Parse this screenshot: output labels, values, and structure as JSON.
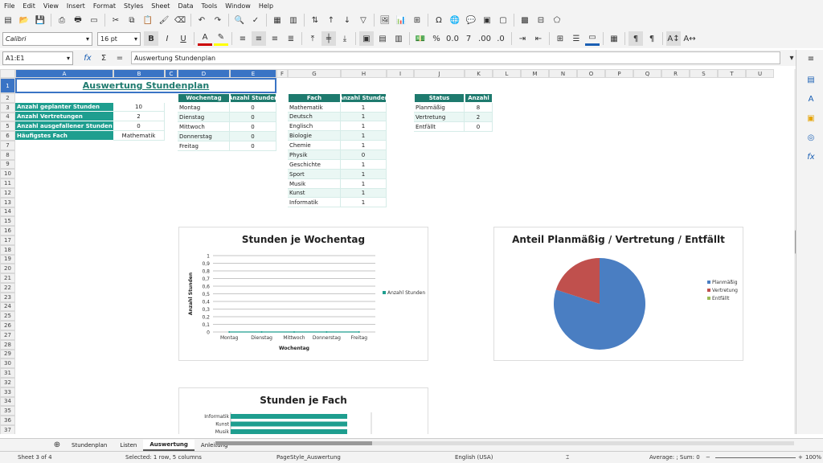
{
  "menu": [
    "File",
    "Edit",
    "View",
    "Insert",
    "Format",
    "Styles",
    "Sheet",
    "Data",
    "Tools",
    "Window",
    "Help"
  ],
  "toolbar": {
    "font_name": "Calibri",
    "font_size": "16 pt"
  },
  "formula_bar": {
    "name_box": "A1:E1",
    "content": "Auswertung Stundenplan",
    "fx": "fx",
    "sigma": "Σ",
    "eq": "="
  },
  "columns": [
    "A",
    "B",
    "C",
    "D",
    "E",
    "F",
    "G",
    "H",
    "I",
    "J",
    "K",
    "L",
    "M",
    "N",
    "O",
    "P",
    "Q",
    "R",
    "S",
    "T",
    "U"
  ],
  "rows": [
    "1",
    "2",
    "3",
    "4",
    "5",
    "6",
    "7",
    "8",
    "9",
    "10",
    "11",
    "12",
    "13",
    "14",
    "15",
    "16",
    "17",
    "18",
    "19",
    "20",
    "21",
    "22",
    "23",
    "24",
    "25",
    "26",
    "27",
    "28",
    "29",
    "30",
    "31",
    "32",
    "33",
    "34",
    "35",
    "36",
    "37"
  ],
  "title_cell": "Auswertung Stundenplan",
  "summary": [
    {
      "label": "Anzahl geplanter Stunden",
      "value": "10"
    },
    {
      "label": "Anzahl Vertretungen",
      "value": "2"
    },
    {
      "label": "Anzahl ausgefallener Stunden",
      "value": "0"
    },
    {
      "label": "Häufigstes Fach",
      "value": "Mathematik"
    }
  ],
  "weekday_table": {
    "headers": [
      "Wochentag",
      "Anzahl Stunden"
    ],
    "rows": [
      [
        "Montag",
        "0"
      ],
      [
        "Dienstag",
        "0"
      ],
      [
        "Mittwoch",
        "0"
      ],
      [
        "Donnerstag",
        "0"
      ],
      [
        "Freitag",
        "0"
      ]
    ]
  },
  "fach_table": {
    "headers": [
      "Fach",
      "Anzahl Stunden"
    ],
    "rows": [
      [
        "Mathematik",
        "1"
      ],
      [
        "Deutsch",
        "1"
      ],
      [
        "Englisch",
        "1"
      ],
      [
        "Biologie",
        "1"
      ],
      [
        "Chemie",
        "1"
      ],
      [
        "Physik",
        "0"
      ],
      [
        "Geschichte",
        "1"
      ],
      [
        "Sport",
        "1"
      ],
      [
        "Musik",
        "1"
      ],
      [
        "Kunst",
        "1"
      ],
      [
        "Informatik",
        "1"
      ]
    ]
  },
  "status_table": {
    "headers": [
      "Status",
      "Anzahl"
    ],
    "rows": [
      [
        "Planmäßig",
        "8"
      ],
      [
        "Vertretung",
        "2"
      ],
      [
        "Entfällt",
        "0"
      ]
    ]
  },
  "chart_data": [
    {
      "type": "line",
      "title": "Stunden je Wochentag",
      "xlabel": "Wochentag",
      "ylabel": "Anzahl Stunden",
      "categories": [
        "Montag",
        "Dienstag",
        "Mittwoch",
        "Donnerstag",
        "Freitag"
      ],
      "yticks": [
        "0",
        "0,1",
        "0,2",
        "0,3",
        "0,4",
        "0,5",
        "0,6",
        "0,7",
        "0,8",
        "0,9",
        "1"
      ],
      "ylim": [
        0,
        1
      ],
      "series": [
        {
          "name": "Anzahl Stunden",
          "values": [
            0,
            0,
            0,
            0,
            0
          ]
        }
      ],
      "legend": "right",
      "grid": true
    },
    {
      "type": "pie",
      "title": "Anteil Planmäßig / Vertretung / Entfällt",
      "categories": [
        "Planmäßig",
        "Vertretung",
        "Entfällt"
      ],
      "values": [
        8,
        2,
        0
      ],
      "colors": [
        "#4a7ec2",
        "#c0504d",
        "#9bbb59"
      ],
      "legend": "right"
    },
    {
      "type": "bar",
      "title": "Stunden je Fach",
      "categories": [
        "Informatik",
        "Kunst",
        "Musik"
      ],
      "values": [
        1,
        1,
        1
      ],
      "color": "#1e9e8f"
    }
  ],
  "sheet_tabs": [
    "Stundenplan",
    "Listen",
    "Auswertung",
    "Anleitung"
  ],
  "active_tab": "Auswertung",
  "status": {
    "sheet": "Sheet 3 of 4",
    "selection": "Selected: 1 row, 5 columns",
    "pagestyle": "PageStyle_Auswertung",
    "language": "English (USA)",
    "sum": "Average: ; Sum: 0",
    "zoom": "100%"
  }
}
